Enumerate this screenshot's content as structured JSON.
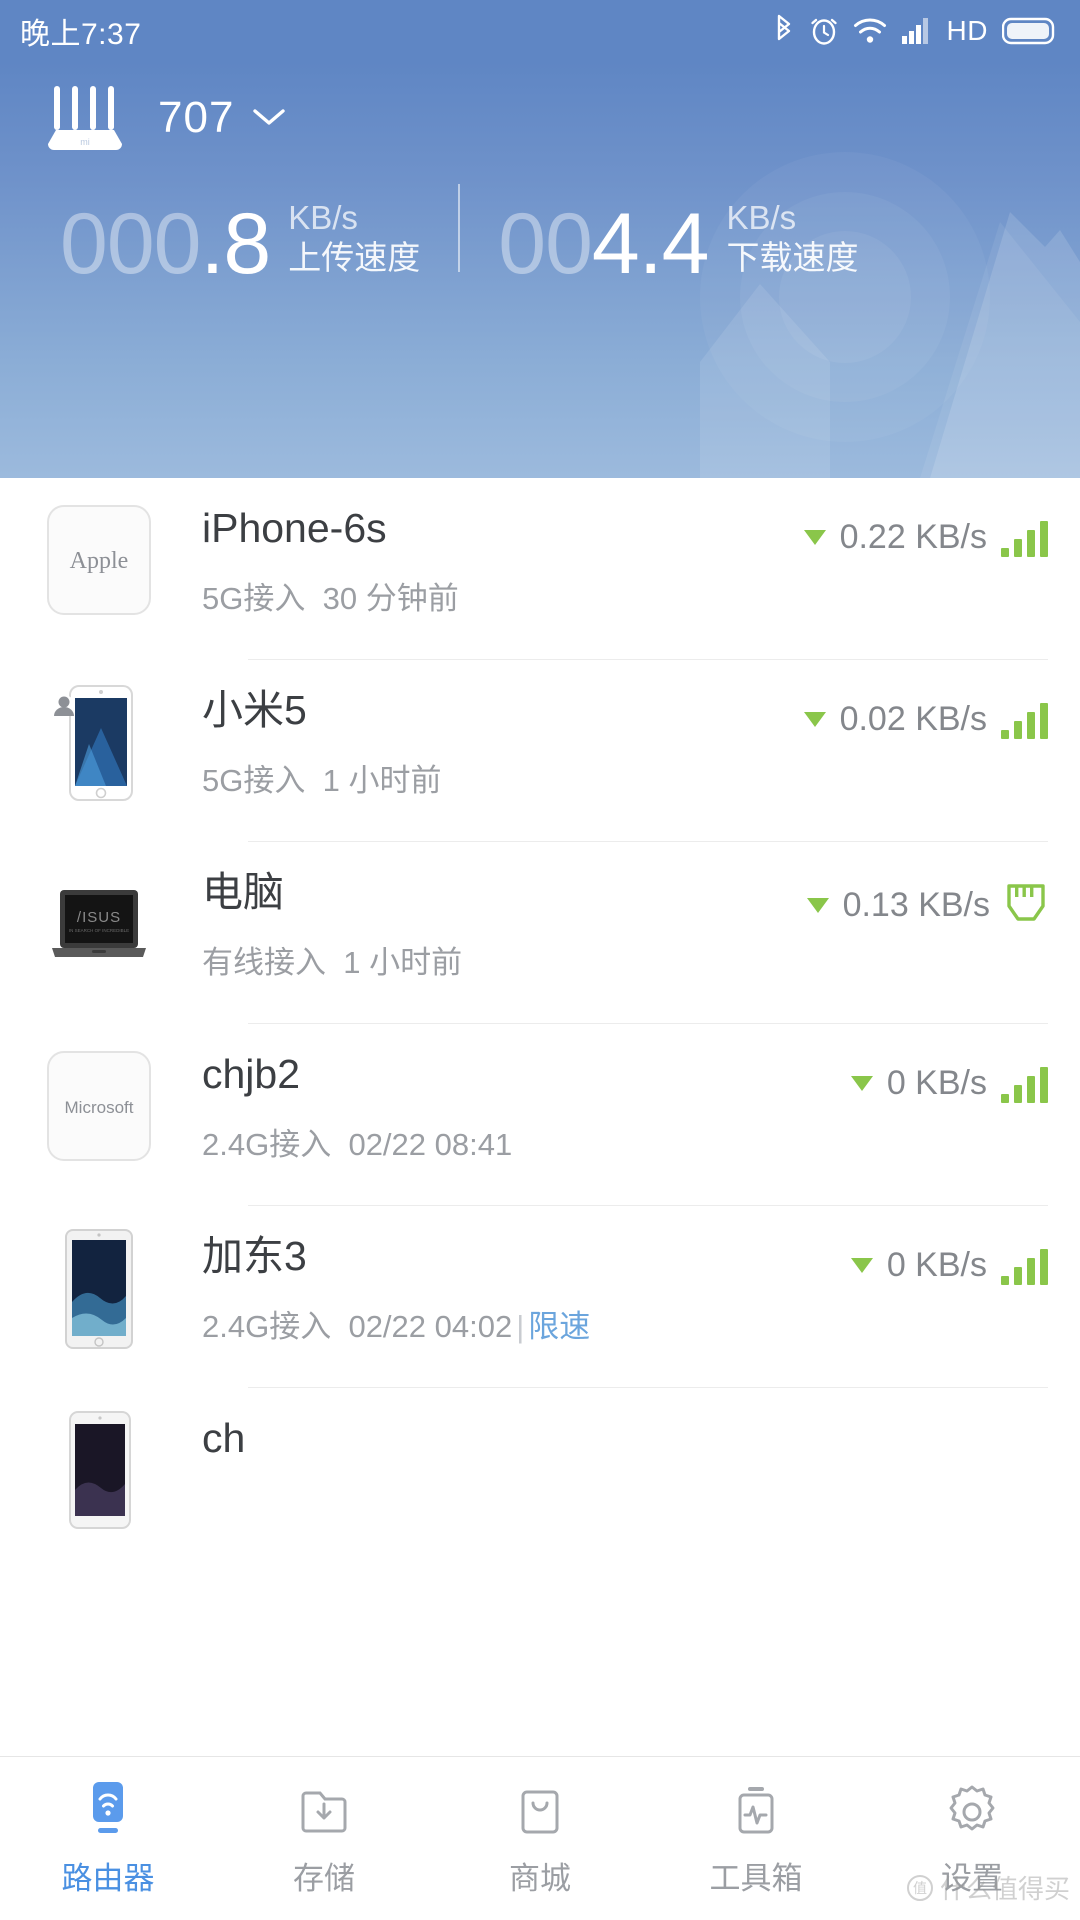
{
  "status_bar": {
    "time": "晚上7:37",
    "icons": [
      "bluetooth-icon",
      "alarm-icon",
      "wifi-icon",
      "cellular-signal-icon",
      "hd-icon",
      "battery-icon"
    ],
    "hd_label": "HD"
  },
  "header": {
    "router_icon": "router-icon",
    "router_name": "707",
    "chevron": "chevron-down-icon",
    "upload": {
      "dim_digits": "000",
      "value": ".8",
      "unit": "KB/s",
      "caption": "上传速度"
    },
    "download": {
      "dim_digits": "00",
      "value": "4.4",
      "unit": "KB/s",
      "caption": "下载速度"
    }
  },
  "devices": [
    {
      "name": "iPhone-6s",
      "icon": "apple-logo-icon",
      "icon_label": "Apple",
      "connection": "5G接入",
      "last_seen": "30 分钟前",
      "limit_label": "",
      "speed": "0.22 KB/s",
      "arrow": "down-arrow-icon",
      "signal": "wifi-bars-icon",
      "bars": 4
    },
    {
      "name": "小米5",
      "icon": "xiaomi-phone-icon",
      "icon_label": "",
      "connection": "5G接入",
      "last_seen": "1 小时前",
      "limit_label": "",
      "speed": "0.02 KB/s",
      "arrow": "down-arrow-icon",
      "signal": "wifi-bars-icon",
      "bars": 4
    },
    {
      "name": "电脑",
      "icon": "asus-laptop-icon",
      "icon_label": "",
      "connection": "有线接入",
      "last_seen": "1 小时前",
      "limit_label": "",
      "speed": "0.13 KB/s",
      "arrow": "down-arrow-icon",
      "signal": "ethernet-port-icon",
      "bars": 0
    },
    {
      "name": "chjb2",
      "icon": "microsoft-logo-icon",
      "icon_label": "Microsoft",
      "connection": "2.4G接入",
      "last_seen": "02/22 08:41",
      "limit_label": "",
      "speed": "0 KB/s",
      "arrow": "down-arrow-icon",
      "signal": "wifi-bars-icon",
      "bars": 4
    },
    {
      "name": "加东3",
      "icon": "ipad-icon",
      "icon_label": "",
      "connection": "2.4G接入",
      "last_seen": "02/22 04:02",
      "limit_label": "限速",
      "speed": "0 KB/s",
      "arrow": "down-arrow-icon",
      "signal": "wifi-bars-icon",
      "bars": 4
    },
    {
      "name": "ch",
      "icon": "iphone-icon",
      "icon_label": "",
      "connection": "",
      "last_seen": "",
      "limit_label": "",
      "speed": "",
      "arrow": "",
      "signal": "",
      "bars": 0
    }
  ],
  "tabbar": {
    "items": [
      {
        "label": "路由器",
        "icon": "router-wifi-icon",
        "active": true
      },
      {
        "label": "存储",
        "icon": "folder-download-icon",
        "active": false
      },
      {
        "label": "商城",
        "icon": "shop-bag-icon",
        "active": false
      },
      {
        "label": "工具箱",
        "icon": "toolbox-pulse-icon",
        "active": false
      },
      {
        "label": "设置",
        "icon": "gear-icon",
        "active": false
      }
    ]
  },
  "watermark": {
    "text": "什么值得买"
  },
  "colors": {
    "header_blue": "#5f86c4",
    "accent_green": "#8ac64a",
    "link_blue": "#6ba5dd",
    "tab_active": "#4a90e2"
  }
}
